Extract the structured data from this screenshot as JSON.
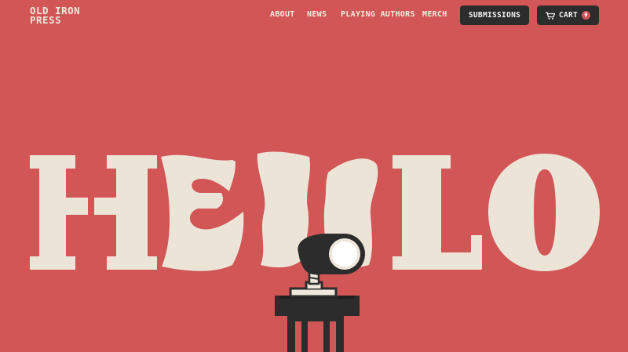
{
  "brand": {
    "line1": "OLD IRON",
    "line2": "PRESS"
  },
  "nav": {
    "items": [
      {
        "label": "ABOUT"
      },
      {
        "label": "NEWS"
      },
      {
        "label": "PLAYING AUTHORS"
      },
      {
        "label": "MERCH"
      }
    ],
    "submissions_label": "SUBMISSIONS",
    "cart_label": "CART",
    "cart_count": "0"
  },
  "hero": {
    "text": "HELLO",
    "icons": [
      "microphone-icon",
      "podium-icon"
    ]
  },
  "colors": {
    "background": "#d25656",
    "letters": "#ece4d7",
    "dark": "#2c2c2c"
  }
}
